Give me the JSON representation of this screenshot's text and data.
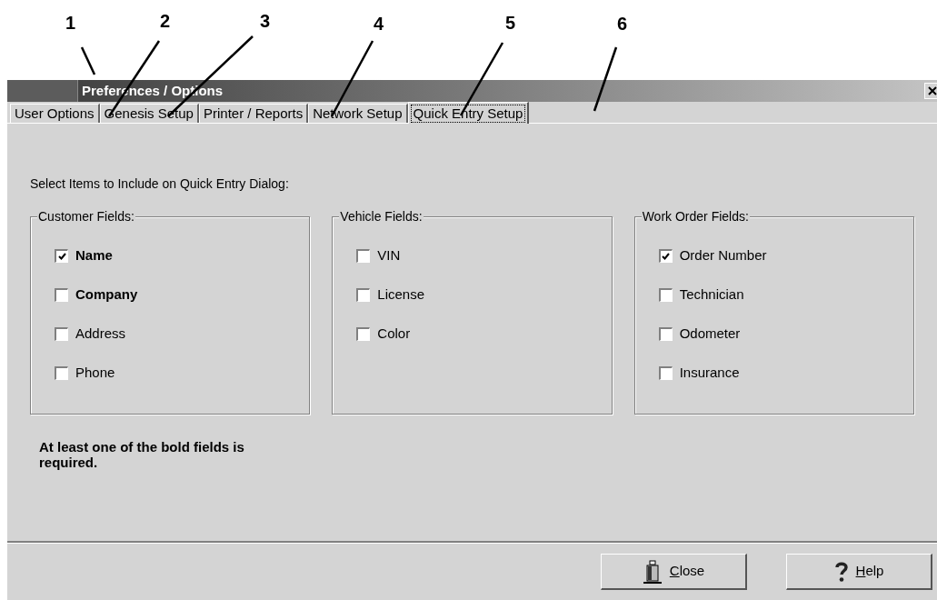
{
  "callouts": [
    "1",
    "2",
    "3",
    "4",
    "5",
    "6"
  ],
  "window": {
    "title": "Preferences / Options"
  },
  "tabs": [
    {
      "label": "User Options",
      "selected": false
    },
    {
      "label": "Genesis Setup",
      "selected": false
    },
    {
      "label": "Printer / Reports",
      "selected": false
    },
    {
      "label": "Network Setup",
      "selected": false
    },
    {
      "label": "Quick Entry Setup",
      "selected": true
    }
  ],
  "instruction": "Select Items to Include on Quick Entry Dialog:",
  "groups": [
    {
      "title": "Customer Fields:",
      "items": [
        {
          "label": "Name",
          "checked": true,
          "bold": true
        },
        {
          "label": "Company",
          "checked": false,
          "bold": true
        },
        {
          "label": "Address",
          "checked": false,
          "bold": false
        },
        {
          "label": "Phone",
          "checked": false,
          "bold": false
        }
      ]
    },
    {
      "title": "Vehicle Fields:",
      "items": [
        {
          "label": "VIN",
          "checked": false,
          "bold": false
        },
        {
          "label": "License",
          "checked": false,
          "bold": false
        },
        {
          "label": "Color",
          "checked": false,
          "bold": false
        }
      ]
    },
    {
      "title": "Work Order Fields:",
      "items": [
        {
          "label": "Order Number",
          "checked": true,
          "bold": false
        },
        {
          "label": "Technician",
          "checked": false,
          "bold": false
        },
        {
          "label": "Odometer",
          "checked": false,
          "bold": false
        },
        {
          "label": "Insurance",
          "checked": false,
          "bold": false
        }
      ]
    }
  ],
  "note": "At least one of the bold fields is required.",
  "buttons": [
    {
      "kind": "close",
      "label": "Close"
    },
    {
      "kind": "help",
      "label": "Help"
    }
  ]
}
